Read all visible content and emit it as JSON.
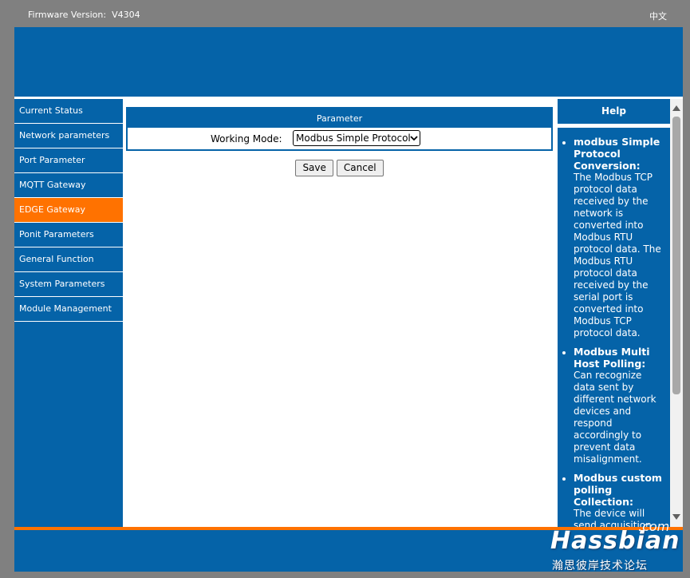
{
  "header": {
    "firmware_label": "Firmware Version:",
    "firmware_value": "V4304",
    "language": "中文"
  },
  "sidebar": {
    "items": [
      {
        "label": "Current Status"
      },
      {
        "label": "Network parameters"
      },
      {
        "label": "Port Parameter"
      },
      {
        "label": "MQTT Gateway"
      },
      {
        "label": "EDGE Gateway"
      },
      {
        "label": "Ponit Parameters"
      },
      {
        "label": "General Function"
      },
      {
        "label": "System Parameters"
      },
      {
        "label": "Module Management"
      }
    ],
    "active_item": "EDGE Gateway"
  },
  "main": {
    "section_title": "Parameter",
    "working_mode_label": "Working Mode:",
    "working_mode_value": "Modbus Simple Protocol",
    "save_label": "Save",
    "cancel_label": "Cancel"
  },
  "help": {
    "title": "Help",
    "items": [
      {
        "title": "modbus Simple Protocol Conversion:",
        "text": "The Modbus TCP protocol data received by the network is converted into Modbus RTU protocol data. The Modbus RTU protocol data received by the serial port is converted into Modbus TCP protocol data."
      },
      {
        "title": "Modbus Multi Host Polling:",
        "text": "Can recognize data sent by different network devices and respond accordingly to prevent data misalignment."
      },
      {
        "title": "Modbus custom polling Collection:",
        "text": "The device will send acquisition commands for"
      }
    ]
  },
  "watermark": {
    "suffix": ".com",
    "brand": "Hassbian",
    "subtitle": "瀚思彼岸技术论坛"
  },
  "colors": {
    "primary": "#0563a8",
    "accent": "#ff7200",
    "frame": "#808080"
  }
}
